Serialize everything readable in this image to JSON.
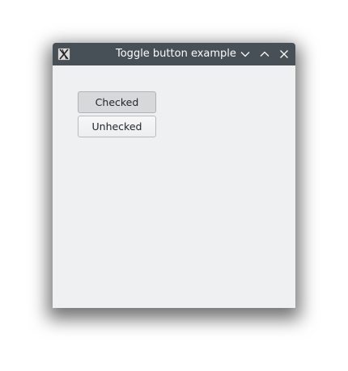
{
  "window": {
    "title": "Toggle button example",
    "controls": {
      "minimize_icon": "chevron-down-icon",
      "maximize_icon": "chevron-up-icon",
      "close_icon": "close-icon"
    }
  },
  "buttons": [
    {
      "label": "Checked",
      "state": "checked"
    },
    {
      "label": "Unhecked",
      "state": "unchecked"
    }
  ],
  "colors": {
    "titlebar": "#475057",
    "client_bg": "#eff0f1",
    "checked_bg": "#d6d8da",
    "text": "#232629"
  }
}
